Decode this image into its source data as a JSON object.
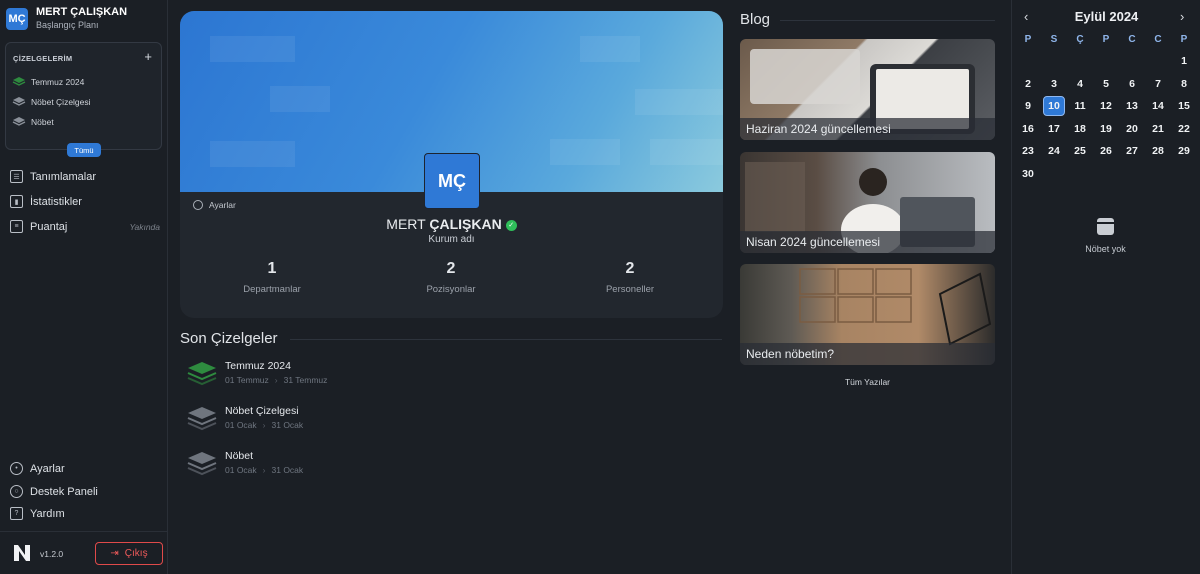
{
  "user": {
    "initials": "MÇ",
    "name": "MERT ÇALIŞKAN",
    "plan": "Başlangıç Planı"
  },
  "schedules_panel": {
    "title": "ÇİZELGELERİM",
    "add_icon": "plus-icon",
    "items": [
      {
        "label": "Temmuz 2024",
        "color": "#2e8b3f"
      },
      {
        "label": "Nöbet Çizelgesi",
        "color": "#7a8089"
      },
      {
        "label": "Nöbet",
        "color": "#7a8089"
      }
    ],
    "all_label": "Tümü"
  },
  "nav": {
    "items": [
      {
        "label": "Tanımlamalar",
        "icon": "checklist-icon"
      },
      {
        "label": "İstatistikler",
        "icon": "bar-chart-icon"
      },
      {
        "label": "Puantaj",
        "icon": "document-icon",
        "badge": "Yakında"
      }
    ],
    "bottom_items": [
      {
        "label": "Ayarlar",
        "icon": "gear-icon"
      },
      {
        "label": "Destek Paneli",
        "icon": "lifebuoy-icon"
      },
      {
        "label": "Yardım",
        "icon": "question-icon"
      }
    ]
  },
  "footer": {
    "version": "v1.2.0",
    "logout_label": "Çıkış"
  },
  "profile": {
    "initials": "MÇ",
    "settings_label": "Ayarlar",
    "first_name": "MERT",
    "last_name": "ÇALIŞKAN",
    "org": "Kurum adı",
    "stats": [
      {
        "value": "1",
        "label": "Departmanlar"
      },
      {
        "value": "2",
        "label": "Pozisyonlar"
      },
      {
        "value": "2",
        "label": "Personeller"
      }
    ]
  },
  "recent": {
    "title": "Son Çizelgeler",
    "items": [
      {
        "name": "Temmuz 2024",
        "start": "01 Temmuz",
        "end": "31 Temmuz",
        "color": "#2e8b3f"
      },
      {
        "name": "Nöbet Çizelgesi",
        "start": "01 Ocak",
        "end": "31 Ocak",
        "color": "#6f757e"
      },
      {
        "name": "Nöbet",
        "start": "01 Ocak",
        "end": "31 Ocak",
        "color": "#6f757e"
      }
    ]
  },
  "blog": {
    "title": "Blog",
    "posts": [
      {
        "caption": "Haziran 2024 güncellemesi"
      },
      {
        "caption": "Nisan 2024 güncellemesi"
      },
      {
        "caption": "Neden nöbetim?"
      }
    ],
    "all_label": "Tüm Yazılar"
  },
  "calendar": {
    "month_label": "Eylül 2024",
    "weekdays": [
      "P",
      "S",
      "Ç",
      "P",
      "C",
      "C",
      "P"
    ],
    "days": [
      "",
      "",
      "",
      "",
      "",
      "",
      "1",
      "2",
      "3",
      "4",
      "5",
      "6",
      "7",
      "8",
      "9",
      "10",
      "11",
      "12",
      "13",
      "14",
      "15",
      "16",
      "17",
      "18",
      "19",
      "20",
      "21",
      "22",
      "23",
      "24",
      "25",
      "26",
      "27",
      "28",
      "29",
      "30"
    ],
    "today": "10",
    "empty_label": "Nöbet yok"
  }
}
